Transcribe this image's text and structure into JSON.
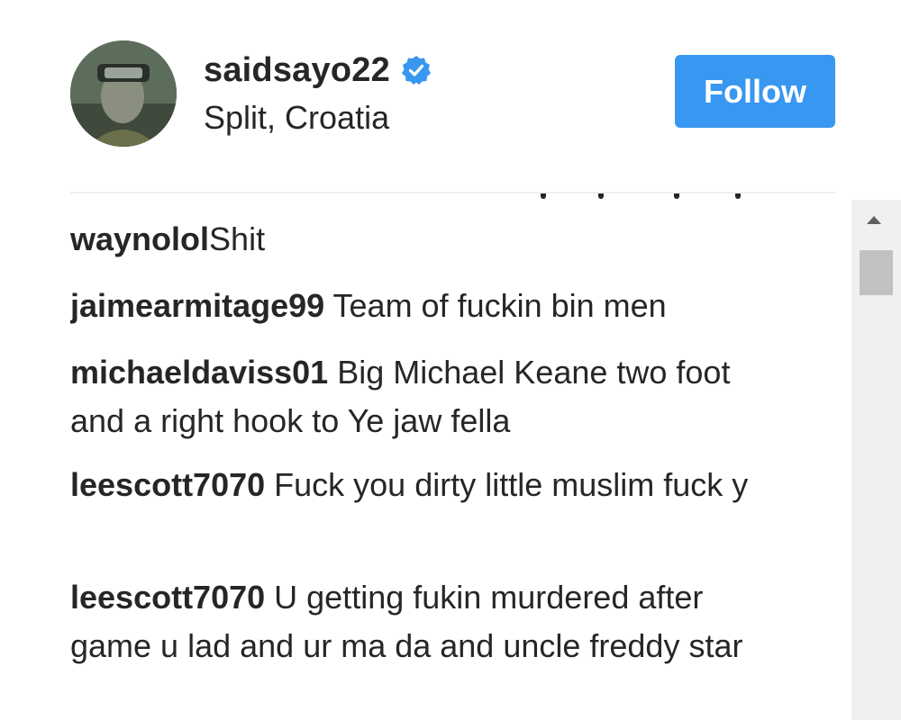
{
  "post_header": {
    "username": "saidsayo22",
    "verified": true,
    "location": "Split, Croatia",
    "follow_label": "Follow",
    "accent_color": "#3897f0"
  },
  "comments": [
    {
      "author": "waynolol",
      "text": "Shit"
    },
    {
      "author": "jaimearmitage99",
      "text": " Team of fuckin bin men"
    },
    {
      "author": "michaeldaviss01",
      "text": " Big Michael Keane two foot and a right hook to Ye jaw fella"
    },
    {
      "author": "leescott7070",
      "text": " Fuck you dirty little muslim fuck y"
    },
    {
      "author": "leescott7070",
      "text": " U getting fukin murdered after game u lad and ur ma da and uncle freddy star"
    }
  ],
  "icons": {
    "verified": "verified-badge-icon",
    "scroll_up": "scroll-up-arrow-icon"
  }
}
